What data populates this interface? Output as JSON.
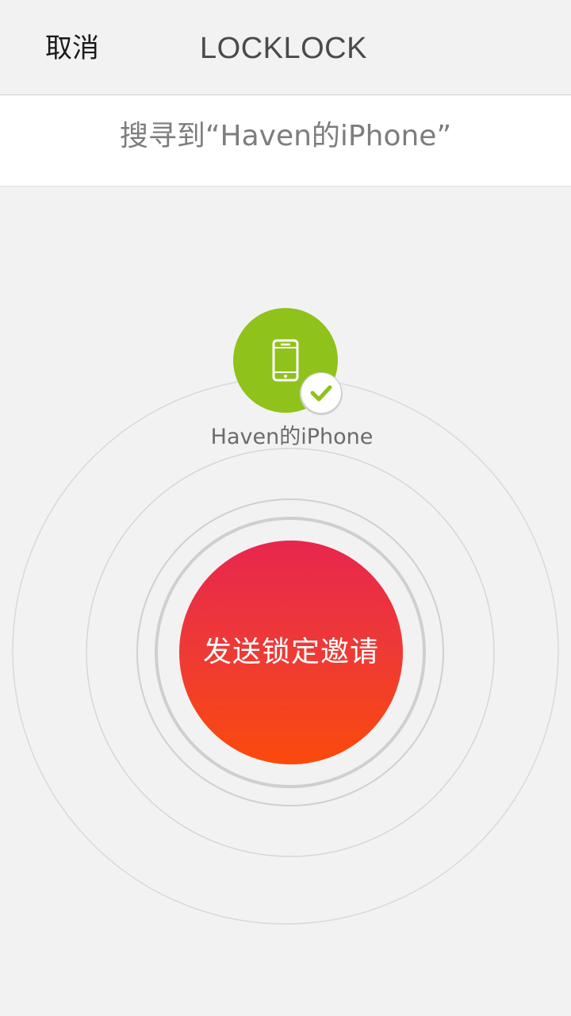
{
  "header": {
    "cancel_label": "取消",
    "title": "LOCKLOCK"
  },
  "status": {
    "text": "搜寻到“Haven的iPhone”"
  },
  "device": {
    "name": "Haven的iPhone",
    "icon": "smartphone-icon",
    "selected_icon": "check-icon",
    "accent_color": "#8fc21a"
  },
  "action": {
    "invite_label": "发送锁定邀请",
    "gradient_top": "#e8264e",
    "gradient_bottom": "#fb4a0c"
  }
}
